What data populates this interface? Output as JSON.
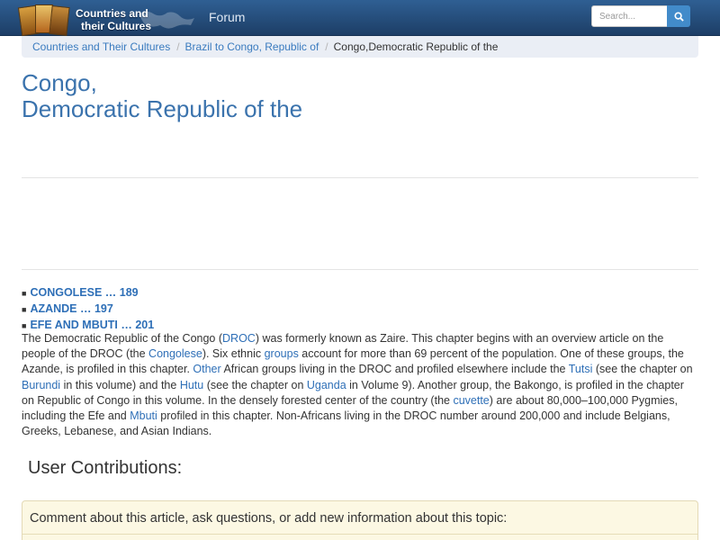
{
  "header": {
    "logo_line1": "Countries and",
    "logo_line2": "their Cultures",
    "forum_label": "Forum",
    "search_placeholder": "Search...",
    "search_icon": "search-icon"
  },
  "breadcrumb": [
    {
      "label": "Countries and Their Cultures"
    },
    {
      "label": "Brazil to Congo, Republic of"
    },
    {
      "label": "Congo,Democratic Republic of the"
    }
  ],
  "title": {
    "line1": "Congo,",
    "line2": "Democratic Republic of the"
  },
  "toc": [
    {
      "label": "CONGOLESE … 189"
    },
    {
      "label": "AZANDE … 197"
    },
    {
      "label": "EFE AND MBUTI … 201"
    }
  ],
  "article": {
    "t1": "The Democratic Republic of the Congo (",
    "l1": "DROC",
    "t2": ") was formerly known as Zaire. This chapter begins with an overview article on the people of the DROC (the ",
    "l2": "Congolese",
    "t3": "). Six ethnic ",
    "l3": "groups",
    "t4": " account for more than 69 percent of the population. One of these groups, the Azande, is profiled in this chapter. ",
    "l4": "Other",
    "t5": " African groups living in the DROC and profiled elsewhere include the ",
    "l5": "Tutsi",
    "t6": " (see the chapter on ",
    "l6": "Burundi",
    "t7": " in this volume) and the ",
    "l7": "Hutu",
    "t8": " (see the chapter on ",
    "l8": "Uganda",
    "t9": " in Volume 9). Another group, the Bakongo, is profiled in the chapter on Republic of Congo in this volume. In the densely forested center of the country (the ",
    "l9": "cuvette",
    "t10": ") are about 80,000–100,000 Pygmies, including the Efe and ",
    "l10": "Mbuti",
    "t11": " profiled in this chapter. Non-Africans living in the DROC number around 200,000 and include Belgians, Greeks, Lebanese, and Asian Indians."
  },
  "contributions": {
    "heading": "User Contributions:",
    "panel_label": "Comment about this article, ask questions, or add new information about this topic:"
  },
  "colors": {
    "navbar": "#2f5f93",
    "link": "#2e6fb7",
    "title": "#3b73ad",
    "search_button": "#428bca",
    "comment_panel": "#fcf8e3"
  }
}
